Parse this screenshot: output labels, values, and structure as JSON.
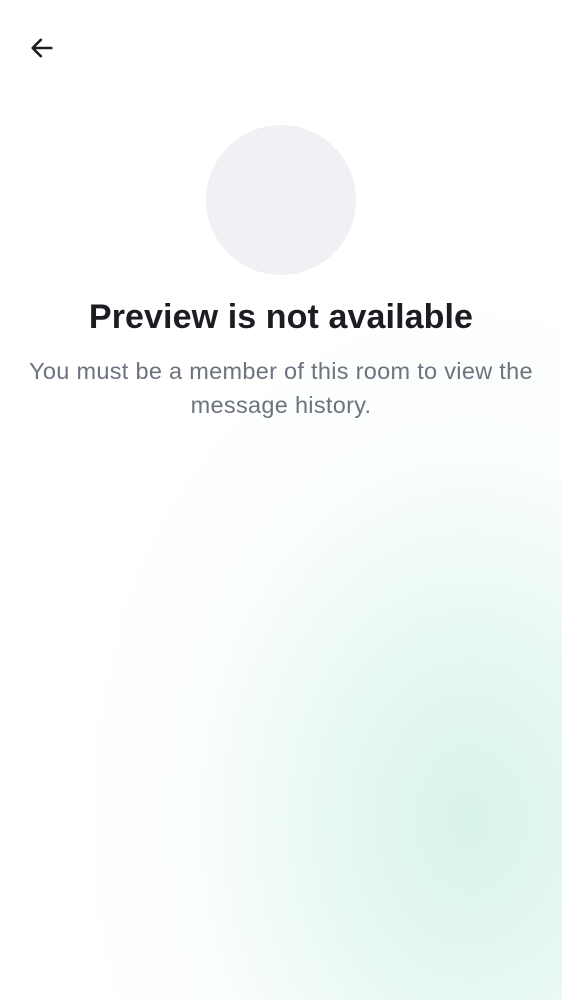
{
  "navigation": {
    "back_icon": "arrow-left-icon"
  },
  "room_preview": {
    "title": "Preview is not available",
    "message": "You must be a member of this room to view the message history."
  },
  "colors": {
    "title": "#1b1d22",
    "subtitle": "#6c737e",
    "avatar_placeholder": "#f0f1f4",
    "gradient_accent": "#d6f3e9"
  }
}
